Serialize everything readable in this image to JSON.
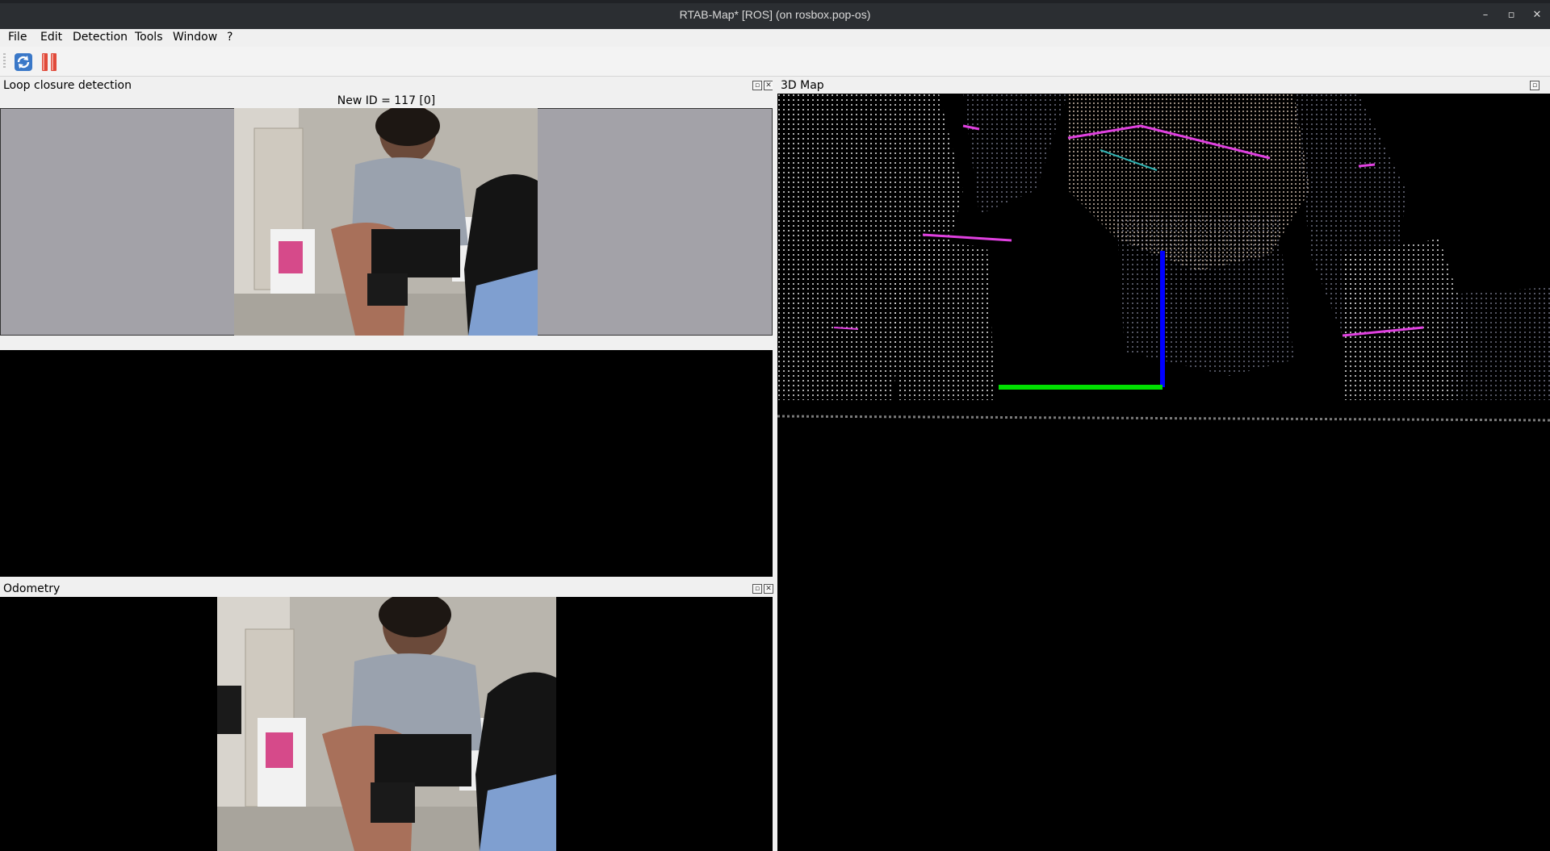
{
  "window": {
    "title": "RTAB-Map* [ROS] (on rosbox.pop-os)",
    "controls": {
      "minimize": "–",
      "maximize": "▫",
      "close": "✕"
    }
  },
  "menu": {
    "items": [
      {
        "label": "File"
      },
      {
        "label": "Edit"
      },
      {
        "label": "Detection"
      },
      {
        "label": "Tools"
      },
      {
        "label": "Window"
      },
      {
        "label": "?"
      }
    ]
  },
  "toolbar": {
    "icons": [
      "refresh-icon",
      "pause-icon"
    ]
  },
  "loop_panel": {
    "title": "Loop closure detection",
    "new_id_label": "New ID = 117 [0]"
  },
  "map_panel": {
    "title": "3D Map"
  },
  "odometry_panel": {
    "title": "Odometry"
  },
  "colors": {
    "titlebar": "#2b2e32",
    "loop_background": "#a3a2a8",
    "axis_x": "#00e000",
    "axis_z": "#0000ff",
    "feature_line": "#e040e0"
  }
}
